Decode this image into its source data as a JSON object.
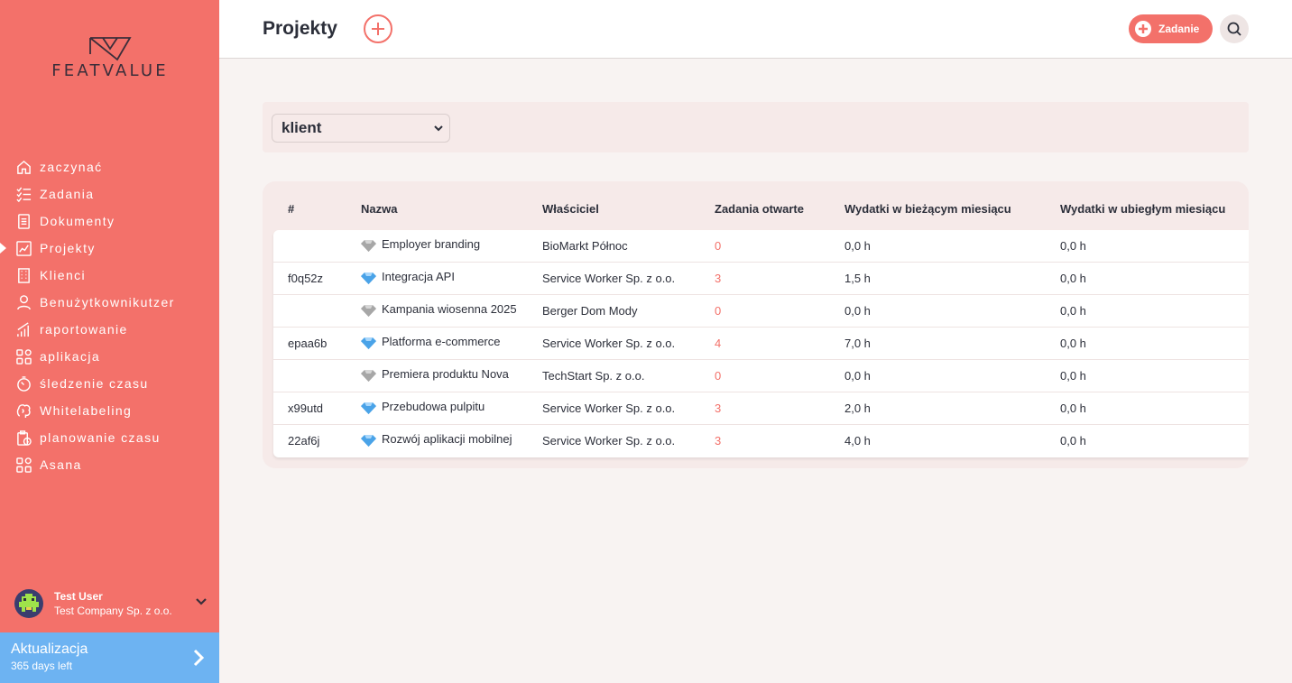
{
  "brand": {
    "name": "FEATVALUE"
  },
  "sidebar": {
    "items": [
      {
        "label": "zaczynać",
        "icon": "home-icon"
      },
      {
        "label": "Zadania",
        "icon": "checklist-icon"
      },
      {
        "label": "Dokumenty",
        "icon": "document-icon"
      },
      {
        "label": "Projekty",
        "icon": "chart-icon",
        "active": true
      },
      {
        "label": "Klienci",
        "icon": "building-icon"
      },
      {
        "label": "Benużytkownikutzer",
        "icon": "user-icon"
      },
      {
        "label": "raportowanie",
        "icon": "bar-chart-icon"
      },
      {
        "label": "aplikacja",
        "icon": "apps-icon"
      },
      {
        "label": "śledzenie czasu",
        "icon": "stopwatch-icon"
      },
      {
        "label": "Whitelabeling",
        "icon": "brain-icon"
      },
      {
        "label": "planowanie czasu",
        "icon": "clipboard-clock-icon"
      },
      {
        "label": "Asana",
        "icon": "apps-icon"
      }
    ]
  },
  "user": {
    "name": "Test User",
    "company": "Test Company Sp. z o.o."
  },
  "upgrade": {
    "title": "Aktualizacja",
    "subtitle": "365 days left"
  },
  "header": {
    "title": "Projekty",
    "task_button": "Zadanie"
  },
  "filter": {
    "selected": "klient"
  },
  "table": {
    "columns": [
      "#",
      "Nazwa",
      "Właściciel",
      "Zadania otwarte",
      "Wydatki w bieżącym miesiącu",
      "Wydatki w ubiegłym miesiącu"
    ],
    "rows": [
      {
        "id": "",
        "name": "Employer branding",
        "gem": "gray",
        "owner": "BioMarkt Północ",
        "open": "0",
        "current": "0,0 h",
        "last": "0,0 h"
      },
      {
        "id": "f0q52z",
        "name": "Integracja API",
        "gem": "blue",
        "owner": "Service Worker Sp. z o.o.",
        "open": "3",
        "current": "1,5 h",
        "last": "0,0 h"
      },
      {
        "id": "",
        "name": "Kampania wiosenna 2025",
        "gem": "gray",
        "owner": "Berger Dom Mody",
        "open": "0",
        "current": "0,0 h",
        "last": "0,0 h"
      },
      {
        "id": "epaa6b",
        "name": "Platforma e-commerce",
        "gem": "blue",
        "owner": "Service Worker Sp. z o.o.",
        "open": "4",
        "current": "7,0 h",
        "last": "0,0 h"
      },
      {
        "id": "",
        "name": "Premiera produktu Nova",
        "gem": "gray",
        "owner": "TechStart Sp. z o.o.",
        "open": "0",
        "current": "0,0 h",
        "last": "0,0 h"
      },
      {
        "id": "x99utd",
        "name": "Przebudowa pulpitu",
        "gem": "blue",
        "owner": "Service Worker Sp. z o.o.",
        "open": "3",
        "current": "2,0 h",
        "last": "0,0 h"
      },
      {
        "id": "22af6j",
        "name": "Rozwój aplikacji mobilnej",
        "gem": "blue",
        "owner": "Service Worker Sp. z o.o.",
        "open": "3",
        "current": "4,0 h",
        "last": "0,0 h"
      }
    ]
  },
  "colors": {
    "accent": "#f3716a",
    "upgrade": "#6db3f2",
    "gem_blue": "#4aa3e8",
    "gem_gray": "#a7a7a7"
  }
}
